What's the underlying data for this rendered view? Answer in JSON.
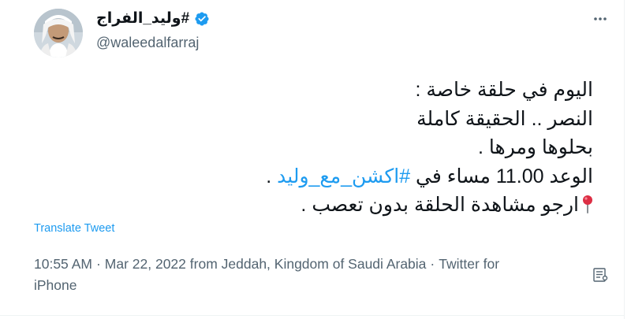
{
  "author": {
    "display_name": "#وليد_الفراج",
    "handle": "@waleedalfarraj",
    "verified": true
  },
  "tweet": {
    "lines": [
      {
        "text": "اليوم في حلقة خاصة :"
      },
      {
        "text": "النصر .. الحقيقة كاملة"
      },
      {
        "text": "بحلوها ومرها ."
      },
      {
        "before": "الوعد 11.00 مساء في ",
        "hashtag": "#اكشن_مع_وليد",
        "after": " ."
      },
      {
        "text": "ارجو مشاهدة الحلقة بدون تعصب ."
      }
    ],
    "pin_emoji": "round-pushpin"
  },
  "actions": {
    "translate": "Translate Tweet",
    "more": "more-icon"
  },
  "meta": {
    "time": "10:55 AM",
    "date": "Mar 22, 2022",
    "location": "from Jeddah, Kingdom of Saudi Arabia",
    "source_line1": "Twitter for",
    "source_line2": "iPhone"
  },
  "colors": {
    "accent": "#1d9bf0",
    "text": "#0f1419",
    "muted": "#536471"
  }
}
